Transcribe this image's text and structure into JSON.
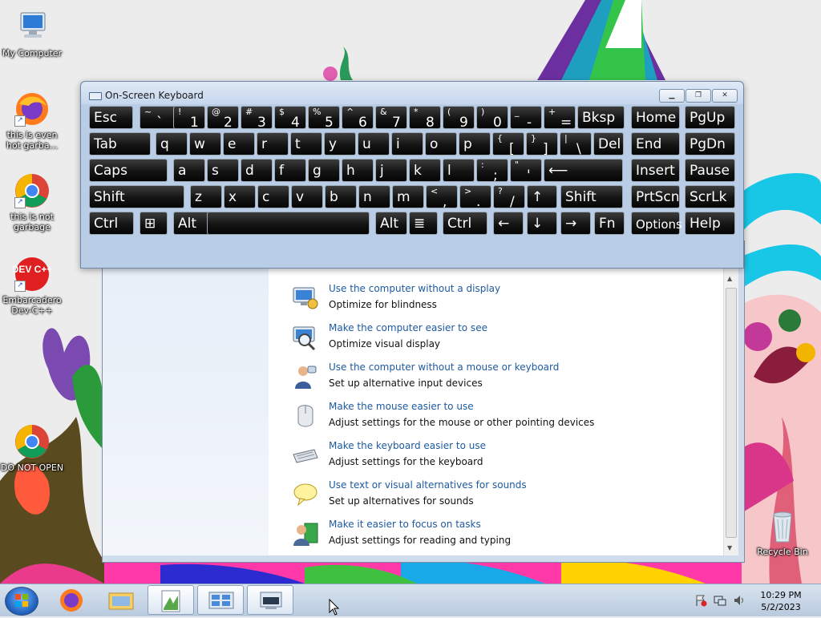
{
  "desktop": {
    "icons": [
      {
        "label": "My Computer"
      },
      {
        "label": "this is even hot garba..."
      },
      {
        "label": "this is not garbage"
      },
      {
        "label": "Embarcadero Dev-C++"
      },
      {
        "label": "DO NOT OPEN"
      },
      {
        "label": "Recycle Bin"
      }
    ],
    "devcpp_logo": "DEV C++"
  },
  "osk": {
    "title": "On-Screen Keyboard",
    "minimize_icon": "minimize-icon",
    "restore_icon": "restore-icon",
    "close_icon": "close-icon",
    "rows": [
      [
        {
          "main": "Esc"
        },
        {
          "top": "~",
          "bot": "`"
        },
        {
          "top": "!",
          "bot": "1"
        },
        {
          "top": "@",
          "bot": "2"
        },
        {
          "top": "#",
          "bot": "3"
        },
        {
          "top": "$",
          "bot": "4"
        },
        {
          "top": "%",
          "bot": "5"
        },
        {
          "top": "^",
          "bot": "6"
        },
        {
          "top": "&",
          "bot": "7"
        },
        {
          "top": "*",
          "bot": "8"
        },
        {
          "top": "(",
          "bot": "9"
        },
        {
          "top": ")",
          "bot": "0"
        },
        {
          "top": "_",
          "bot": "-"
        },
        {
          "top": "+",
          "bot": "="
        },
        {
          "main": "Bksp"
        },
        {
          "main": "Home"
        },
        {
          "main": "PgUp"
        }
      ],
      [
        {
          "main": "Tab"
        },
        {
          "main": "q"
        },
        {
          "main": "w"
        },
        {
          "main": "e"
        },
        {
          "main": "r"
        },
        {
          "main": "t"
        },
        {
          "main": "y"
        },
        {
          "main": "u"
        },
        {
          "main": "i"
        },
        {
          "main": "o"
        },
        {
          "main": "p"
        },
        {
          "top": "{",
          "bot": "["
        },
        {
          "top": "}",
          "bot": "]"
        },
        {
          "top": "|",
          "bot": "\\"
        },
        {
          "main": "Del"
        },
        {
          "main": "End"
        },
        {
          "main": "PgDn"
        }
      ],
      [
        {
          "main": "Caps"
        },
        {
          "main": "a"
        },
        {
          "main": "s"
        },
        {
          "main": "d"
        },
        {
          "main": "f"
        },
        {
          "main": "g"
        },
        {
          "main": "h"
        },
        {
          "main": "j"
        },
        {
          "main": "k"
        },
        {
          "main": "l"
        },
        {
          "top": ":",
          "bot": ";"
        },
        {
          "top": "\"",
          "bot": "'"
        },
        {
          "main": "⟵"
        },
        {
          "main": "Insert"
        },
        {
          "main": "Pause"
        }
      ],
      [
        {
          "main": "Shift"
        },
        {
          "main": "z"
        },
        {
          "main": "x"
        },
        {
          "main": "c"
        },
        {
          "main": "v"
        },
        {
          "main": "b"
        },
        {
          "main": "n"
        },
        {
          "main": "m"
        },
        {
          "top": "<",
          "bot": ","
        },
        {
          "top": ">",
          "bot": "."
        },
        {
          "top": "?",
          "bot": "/"
        },
        {
          "main": "↑"
        },
        {
          "main": "Shift"
        },
        {
          "main": "PrtScn"
        },
        {
          "main": "ScrLk"
        }
      ],
      [
        {
          "main": "Ctrl"
        },
        {
          "main": "⊞"
        },
        {
          "main": "Alt"
        },
        {
          "main": ""
        },
        {
          "main": "Alt"
        },
        {
          "main": "≣"
        },
        {
          "main": "Ctrl"
        },
        {
          "main": "←"
        },
        {
          "main": "↓"
        },
        {
          "main": "→"
        },
        {
          "main": "Fn"
        },
        {
          "main": "Options"
        },
        {
          "main": "Help"
        }
      ]
    ]
  },
  "control_panel": {
    "items": [
      {
        "link": "Use the computer without a display",
        "desc": "Optimize for blindness",
        "icon": "monitor-narrator-icon"
      },
      {
        "link": "Make the computer easier to see",
        "desc": "Optimize visual display",
        "icon": "magnifier-icon"
      },
      {
        "link": "Use the computer without a mouse or keyboard",
        "desc": "Set up alternative input devices",
        "icon": "speech-person-icon"
      },
      {
        "link": "Make the mouse easier to use",
        "desc": "Adjust settings for the mouse or other pointing devices",
        "icon": "mouse-icon"
      },
      {
        "link": "Make the keyboard easier to use",
        "desc": "Adjust settings for the keyboard",
        "icon": "keyboard-icon"
      },
      {
        "link": "Use text or visual alternatives for sounds",
        "desc": "Set up alternatives for sounds",
        "icon": "speech-bubble-icon"
      },
      {
        "link": "Make it easier to focus on tasks",
        "desc": "Adjust settings for reading and typing",
        "icon": "focus-person-icon"
      }
    ]
  },
  "taskbar": {
    "time": "10:29 PM",
    "date": "5/2/2023"
  }
}
